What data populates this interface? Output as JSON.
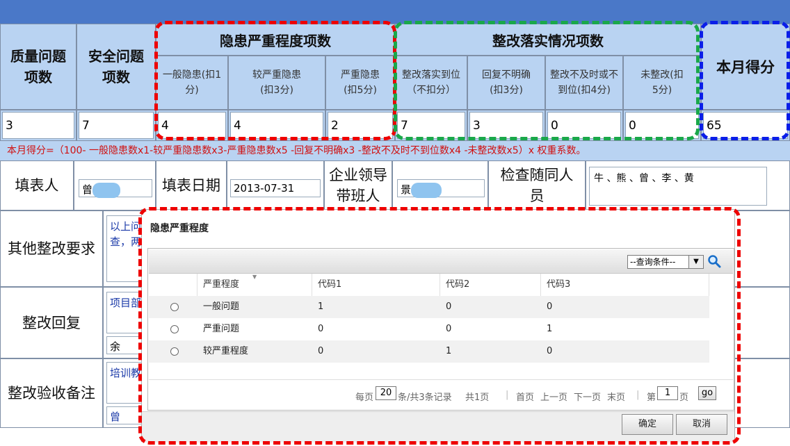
{
  "header": {
    "quality_issues": "质量问题项数",
    "safety_issues": "安全问题项数",
    "severity_group": "隐患严重程度项数",
    "rectify_group": "整改落实情况项数",
    "month_score": "本月得分",
    "severity_cols": [
      "一般隐患(扣1分)",
      "较严重隐患(扣3分)",
      "严重隐患(扣5分)"
    ],
    "rectify_cols": [
      "整改落实到位（不扣分）",
      "回复不明确(扣3分)",
      "整改不及时或不到位(扣4分)",
      "未整改(扣5分)"
    ]
  },
  "values": {
    "quality": "3",
    "safety": "7",
    "general": "4",
    "serious_mid": "4",
    "serious": "2",
    "rectified": "7",
    "unclear": "3",
    "late": "0",
    "not_rectified": "0",
    "score": "65"
  },
  "formula": "本月得分=（100- 一般隐患数x1-较严重隐患数x3-严重隐患数x5 -回复不明确x3 -整改不及时不到位数x4 -未整改数x5）x 权重系数。",
  "form": {
    "filler_label": "填表人",
    "filler_value": "曾",
    "date_label": "填表日期",
    "date_value": "2013-07-31",
    "leader_label": "企业领导带班人",
    "leader_value": "景",
    "companion_label": "检查随同人员",
    "companions": "牛 、熊 、曾 、李 、黄",
    "other_label": "其他整改要求",
    "other_text": "以上问查，两",
    "reply_label": "整改回复",
    "reply_text": "项目部",
    "reply_text2": "余",
    "acceptance_label": "整改验收备注",
    "acceptance_text": "培训教",
    "acceptance_text2": "曾"
  },
  "dialog": {
    "title": "隐患严重程度",
    "query_select": "--查询条件--",
    "columns": [
      "严重程度",
      "代码1",
      "代码2",
      "代码3"
    ],
    "rows": [
      {
        "name": "一般问题",
        "c1": "1",
        "c2": "0",
        "c3": "0"
      },
      {
        "name": "严重问题",
        "c1": "0",
        "c2": "0",
        "c3": "1"
      },
      {
        "name": "较严重程度",
        "c1": "0",
        "c2": "1",
        "c3": "0"
      }
    ],
    "pager": {
      "per_page_label": "每页",
      "per_page": "20",
      "summary": "条/共3条记录",
      "total_pages": "共1页",
      "first": "首页",
      "prev": "上一页",
      "next": "下一页",
      "last": "末页",
      "page_prefix": "第",
      "page": "1",
      "page_suffix": "页",
      "go": "go"
    },
    "ok": "确定",
    "cancel": "取消"
  }
}
